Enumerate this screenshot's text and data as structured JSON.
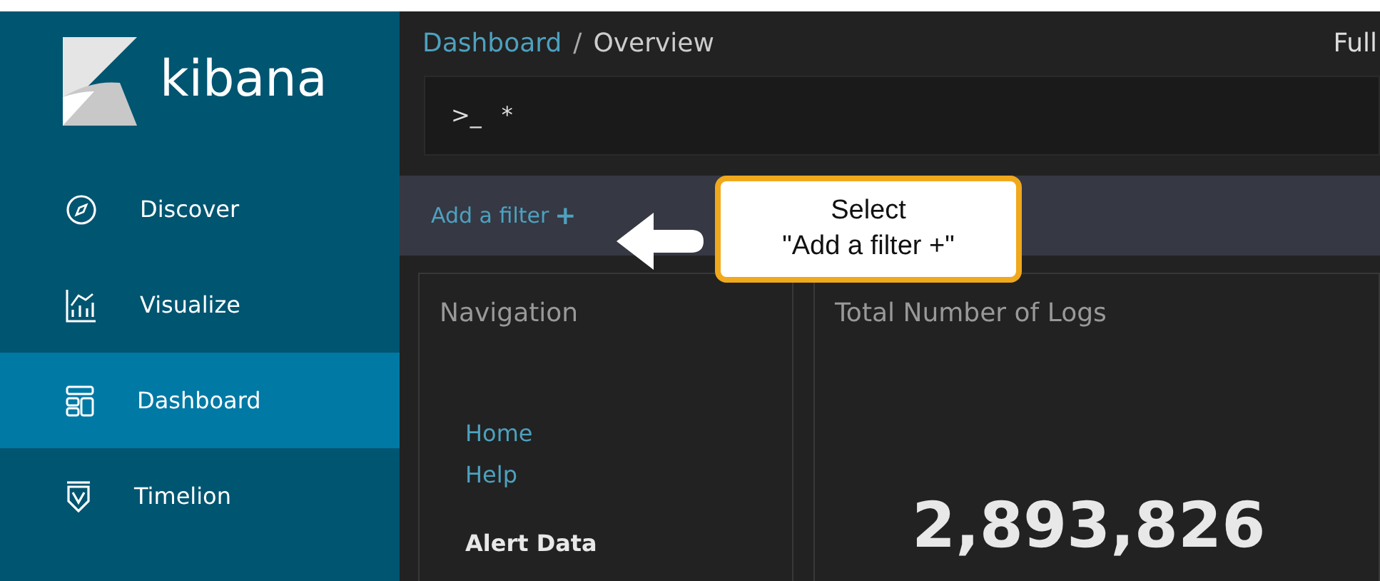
{
  "sidebar": {
    "logo_text": "kibana",
    "items": [
      {
        "label": "Discover",
        "selected": false
      },
      {
        "label": "Visualize",
        "selected": false
      },
      {
        "label": "Dashboard",
        "selected": true
      },
      {
        "label": "Timelion",
        "selected": false
      }
    ]
  },
  "breadcrumb": {
    "parent": "Dashboard",
    "separator": "/",
    "current": "Overview"
  },
  "top_right": "Full",
  "query": {
    "prompt": ">_",
    "value": "*"
  },
  "filter_bar": {
    "label": "Add a filter",
    "plus": "+"
  },
  "callout": {
    "lines": [
      "Select",
      "\"Add a filter +\""
    ]
  },
  "panels": [
    {
      "kind": "links",
      "title": "Navigation",
      "links": [
        "Home",
        "Help"
      ],
      "heading": "Alert Data"
    },
    {
      "kind": "metric",
      "title": "Total Number of Logs",
      "value": "2,893,826"
    }
  ]
}
